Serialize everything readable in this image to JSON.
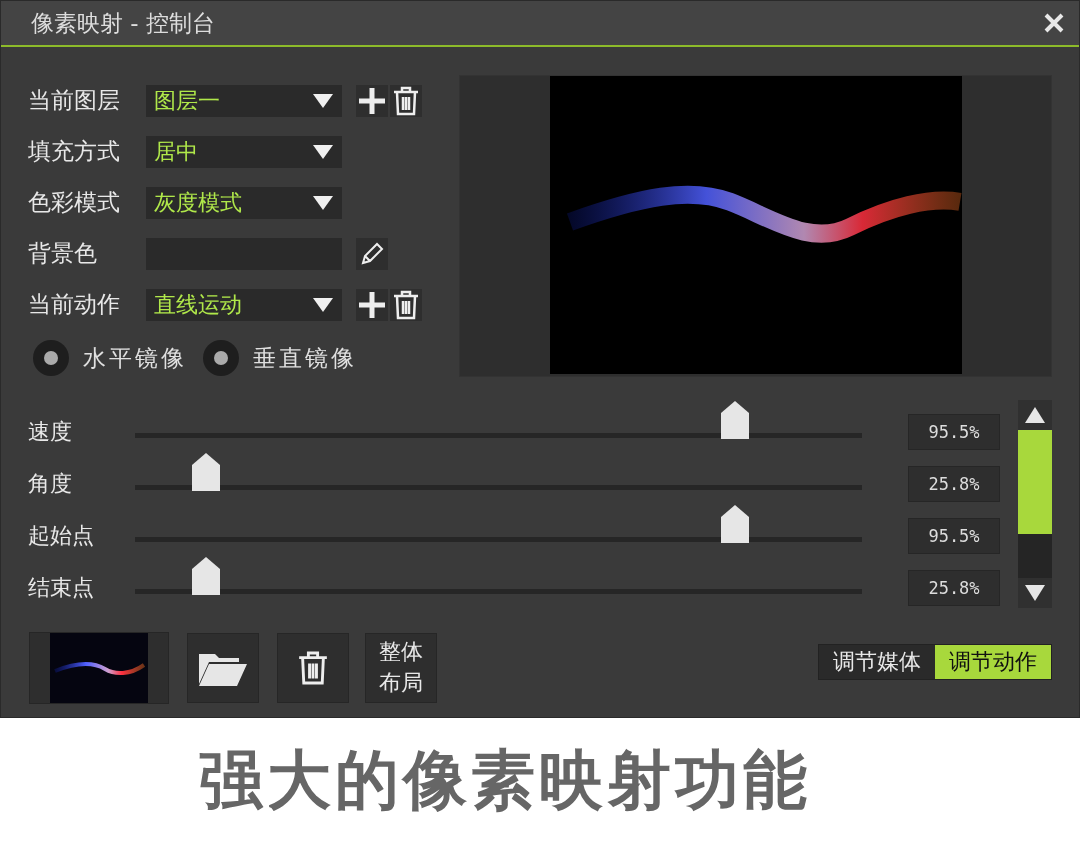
{
  "window": {
    "title": "像素映射 - 控制台"
  },
  "fields": [
    {
      "kind": "dropdown",
      "label": "当前图层",
      "value": "图层一",
      "addable": true
    },
    {
      "kind": "dropdown",
      "label": "填充方式",
      "value": "居中",
      "addable": false
    },
    {
      "kind": "dropdown",
      "label": "色彩模式",
      "value": "灰度模式",
      "addable": false
    },
    {
      "kind": "color",
      "label": "背景色"
    },
    {
      "kind": "dropdown",
      "label": "当前动作",
      "value": "直线运动",
      "addable": true
    }
  ],
  "mirrors": [
    {
      "label": "水平镜像",
      "checked": true
    },
    {
      "label": "垂直镜像",
      "checked": true
    }
  ],
  "sliders": [
    {
      "label": "速度",
      "level": 0.825,
      "reading": "95.5%"
    },
    {
      "label": "角度",
      "level": 0.098,
      "reading": "25.8%"
    },
    {
      "label": "起始点",
      "level": 0.825,
      "reading": "95.5%"
    },
    {
      "label": "结束点",
      "level": 0.098,
      "reading": "25.8%"
    }
  ],
  "layout_button": "整体布局",
  "tabs": [
    {
      "label": "调节媒体",
      "selected": false
    },
    {
      "label": "调节动作",
      "selected": true
    }
  ],
  "caption": "强大的像素映射功能"
}
